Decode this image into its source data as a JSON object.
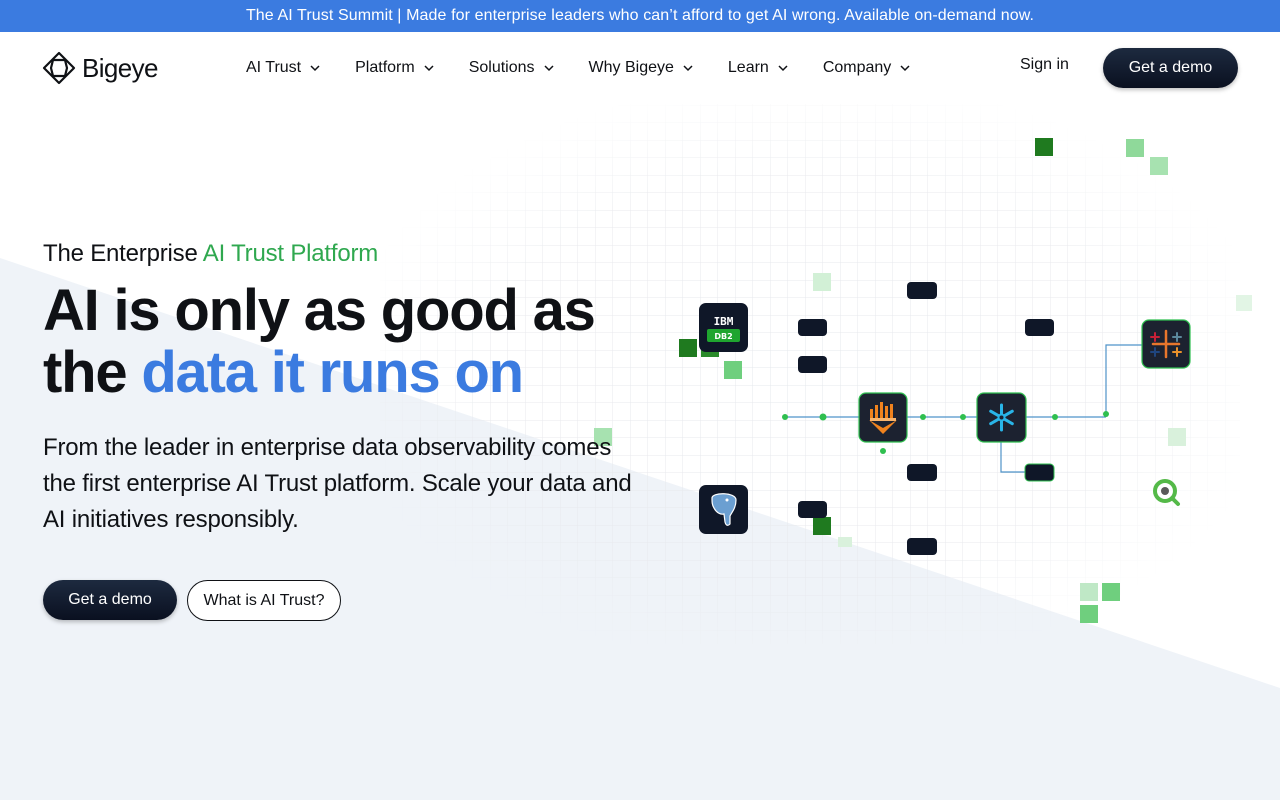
{
  "announcement": {
    "text": "The AI Trust Summit | Made for enterprise leaders who can’t afford to get AI wrong. Available on-demand now."
  },
  "header": {
    "logo_text": "Bigeye",
    "menu": [
      {
        "label": "AI Trust"
      },
      {
        "label": "Platform"
      },
      {
        "label": "Solutions"
      },
      {
        "label": "Why Bigeye"
      },
      {
        "label": "Learn"
      },
      {
        "label": "Company"
      }
    ],
    "signin_label": "Sign in",
    "demo_label": "Get a demo"
  },
  "hero": {
    "eyebrow_prefix": "The Enterprise ",
    "eyebrow_accent": "AI Trust Platform",
    "headline_line1": "AI is only as good as",
    "headline_line2_prefix": "the ",
    "headline_line2_accent": "data it runs on",
    "subtext": "From the leader in enterprise data observability comes the first enterprise AI Trust platform. Scale your data and AI initiatives responsibly.",
    "primary_cta": "Get a demo",
    "secondary_cta": "What is AI Trust?"
  },
  "diagram": {
    "db2_label_top": "IBM",
    "db2_label_bottom": "DB2",
    "icons": [
      "ibm-db2-icon",
      "postgresql-icon",
      "databricks-icon",
      "snowflake-icon",
      "tableau-icon",
      "qlik-icon"
    ]
  },
  "colors": {
    "announcement_bg": "#3b7be0",
    "accent_green": "#2fa84f",
    "accent_blue": "#3b7be0",
    "button_dark": "#0f1728",
    "background_light": "#eff3f8"
  }
}
